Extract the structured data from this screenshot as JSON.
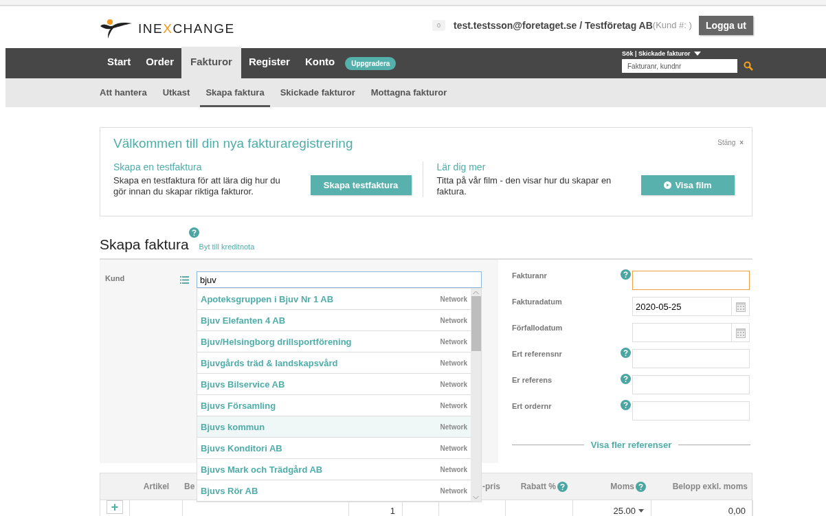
{
  "header": {
    "logo": "INE**X**CHANGE",
    "notifications": "0",
    "user": "test.testsson@foretaget.se / Testföretag AB",
    "customer_no": "(Kund #: )",
    "logout": "Logga ut"
  },
  "nav": {
    "items": [
      {
        "label": "Start",
        "selected": false
      },
      {
        "label": "Order",
        "selected": false
      },
      {
        "label": "Fakturor",
        "selected": true
      },
      {
        "label": "Register",
        "selected": false
      },
      {
        "label": "Konto",
        "selected": false
      }
    ],
    "badge": "Uppgradera",
    "search_scope": "Sök | Skickade fakturor",
    "search": {
      "placeholder": "Fakturanr, kundnr"
    }
  },
  "subnav": [
    {
      "label": "Att hantera",
      "selected": false
    },
    {
      "label": "Utkast",
      "selected": false
    },
    {
      "label": "Skapa faktura",
      "selected": true
    },
    {
      "label": "Skickade fakturor",
      "selected": false
    },
    {
      "label": "Mottagna fakturor",
      "selected": false
    }
  ],
  "welcome": {
    "title": "Välkommen till din nya fakturaregistrering",
    "close": "Stäng",
    "close_icon": "×",
    "columns": [
      {
        "heading": "Skapa en testfaktura",
        "text": "Skapa en testfaktura för att lära dig hur du gör innan du skapar riktiga fakturor.",
        "button": "Skapa testfaktura",
        "kind": "plain"
      },
      {
        "heading": "Lär dig mer",
        "text": "Titta på vår film - den visar hur du skapar en faktura.",
        "button": "Visa film",
        "kind": "play"
      }
    ]
  },
  "page": {
    "title": "Skapa faktura",
    "link": "Byt till kreditnota"
  },
  "customer": {
    "label": "Kund",
    "value": "bjuv",
    "suggestions": [
      {
        "name": "Apoteksgruppen i Bjuv Nr 1 AB",
        "source": "Network",
        "selected": false
      },
      {
        "name": "Bjuv Elefanten 4 AB",
        "source": "Network",
        "selected": false
      },
      {
        "name": "Bjuv/Helsingborg drillsportförening",
        "source": "Network",
        "selected": false
      },
      {
        "name": "Bjuvgårds träd & landskapsvård",
        "source": "Network",
        "selected": false
      },
      {
        "name": "Bjuvs Bilservice AB",
        "source": "Network",
        "selected": false
      },
      {
        "name": "Bjuvs Församling",
        "source": "Network",
        "selected": false
      },
      {
        "name": "Bjuvs kommun",
        "source": "Network",
        "selected": true
      },
      {
        "name": "Bjuvs Konditori AB",
        "source": "Network",
        "selected": false
      },
      {
        "name": "Bjuvs Mark och Trädgård AB",
        "source": "Network",
        "selected": false
      },
      {
        "name": "Bjuvs Rör AB",
        "source": "Network",
        "selected": false
      }
    ]
  },
  "fields": [
    {
      "label": "Fakturanr",
      "help": true,
      "kind": "text",
      "focused": true
    },
    {
      "label": "Fakturadatum",
      "help": false,
      "kind": "date",
      "value": "2020-05-25",
      "focused": false
    },
    {
      "label": "Förfallodatum",
      "help": false,
      "kind": "date",
      "focused": false
    },
    {
      "label": "Ert referensnr",
      "help": true,
      "kind": "text",
      "focused": false
    },
    {
      "label": "Er referens",
      "help": true,
      "kind": "text",
      "focused": false
    },
    {
      "label": "Ert ordernr",
      "help": true,
      "kind": "text",
      "focused": false
    }
  ],
  "more_references": "Visa fler referenser",
  "table": {
    "columns": [
      {
        "label": "Artikel",
        "help": false
      },
      {
        "label": "Be",
        "help": false
      },
      {
        "label": "-pris",
        "help": false
      },
      {
        "label": "Rabatt %",
        "help": true
      },
      {
        "label": "Moms",
        "help": true
      },
      {
        "label": "Belopp exkl. moms",
        "help": false
      }
    ],
    "add_icon": "+",
    "rows": [
      {
        "quantity": "1",
        "vat": "25.00",
        "amount": "0,00"
      }
    ]
  }
}
